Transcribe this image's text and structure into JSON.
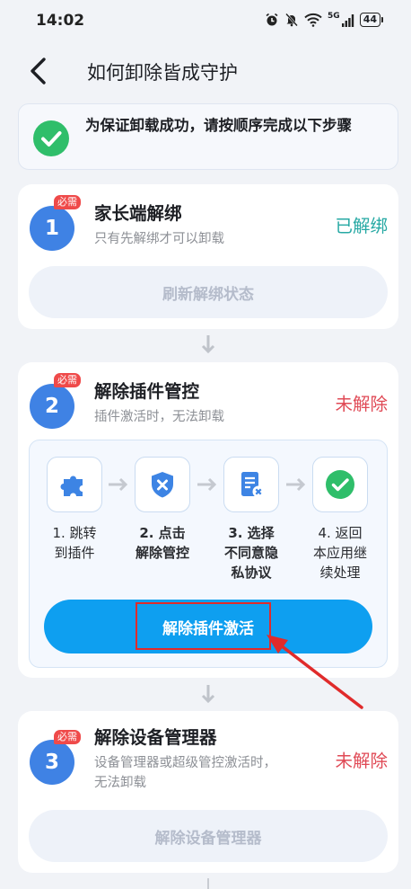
{
  "status_bar": {
    "time": "14:02",
    "network": "5G",
    "battery": "44",
    "icons": [
      "alarm-icon",
      "mute-icon",
      "wifi-icon",
      "signal-icon",
      "battery-icon"
    ]
  },
  "header": {
    "title": "如何卸除皆成守护",
    "back_icon": "back-arrow-icon"
  },
  "notice": {
    "text": "为保证卸载成功，请按顺序完成以下步骤",
    "icon": "check-circle-icon"
  },
  "steps": [
    {
      "number": "1",
      "tag": "必需",
      "title": "家长端解绑",
      "description": "只有先解绑才可以卸载",
      "status": "已解绑",
      "button": "刷新解绑状态"
    },
    {
      "number": "2",
      "tag": "必需",
      "title": "解除插件管控",
      "description": "插件激活时，无法卸载",
      "status": "未解除",
      "substeps": [
        {
          "label_line1": "1. 跳转",
          "label_line2": "到插件",
          "label_line3": "",
          "icon": "puzzle-icon"
        },
        {
          "label_line1": "2. 点击",
          "label_line2": "解除管控",
          "label_line3": "",
          "icon": "shield-x-icon"
        },
        {
          "label_line1": "3. 选择",
          "label_line2": "不同意隐",
          "label_line3": "私协议",
          "icon": "document-x-icon"
        },
        {
          "label_line1": "4. 返回",
          "label_line2": "本应用继",
          "label_line3": "续处理",
          "icon": "check-circle-icon"
        }
      ],
      "button": "解除插件激活"
    },
    {
      "number": "3",
      "tag": "必需",
      "title": "解除设备管理器",
      "description_line1": "设备管理器或超级管控激活时，",
      "description_line2": "无法卸载",
      "status": "未解除",
      "button": "解除设备管理器"
    }
  ],
  "colors": {
    "accent_blue": "#0e9ff0",
    "badge_blue": "#3f82e4",
    "done_teal": "#27a9a4",
    "undone_red": "#e04a56",
    "tag_red": "#ef4a4a",
    "highlight_red": "#e02b2b",
    "success_green": "#2fbe6a"
  }
}
